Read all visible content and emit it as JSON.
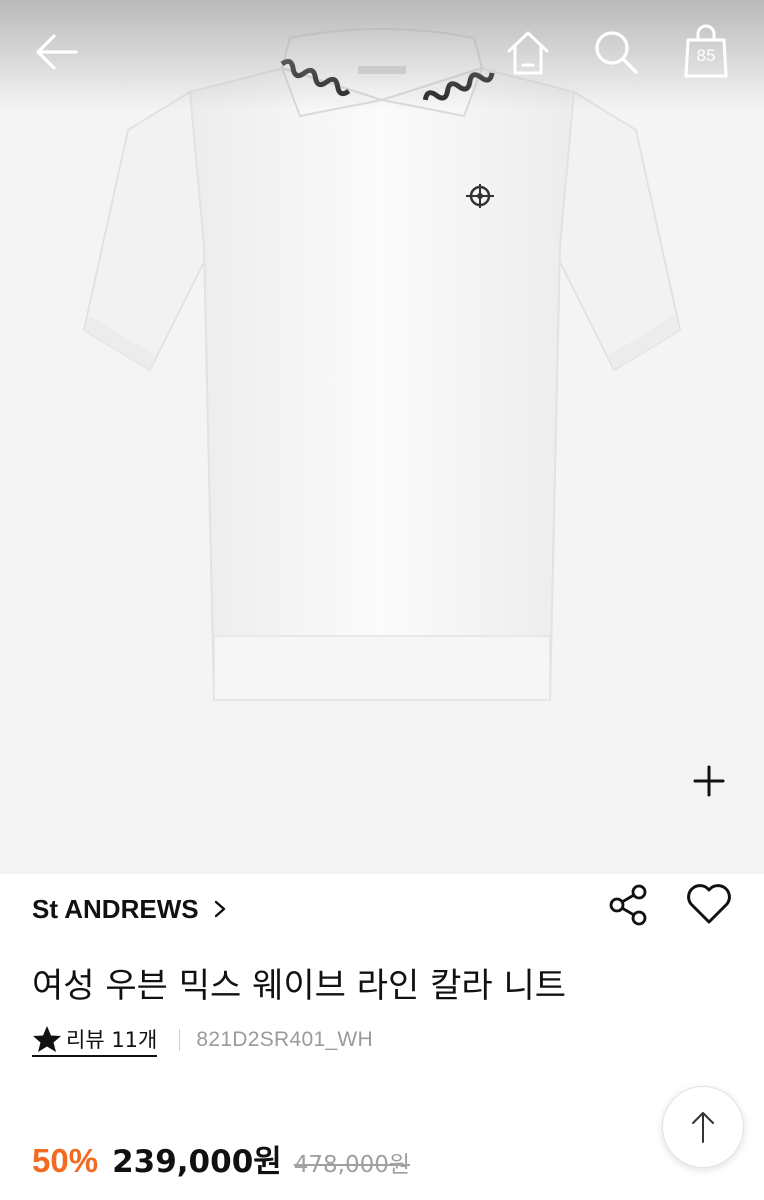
{
  "header": {
    "icons": [
      "back-arrow-icon",
      "home-icon",
      "search-icon",
      "shopping-bag-icon"
    ],
    "cart_count": "85"
  },
  "product": {
    "image_alt": "white short-sleeve knit polo with black wave collar trim",
    "brand": "St ANDREWS",
    "title": "여성 우븐 믹스 웨이브 라인 칼라 니트",
    "review_label": "리뷰 11개",
    "sku": "821D2SR401_WH",
    "discount": "50%",
    "price": "239,000원",
    "original_price": "478,000원"
  },
  "colors": {
    "accent_discount": "#f26b21",
    "text": "#111111",
    "muted": "#9a9a9a",
    "image_bg": "#f4f4f4"
  }
}
